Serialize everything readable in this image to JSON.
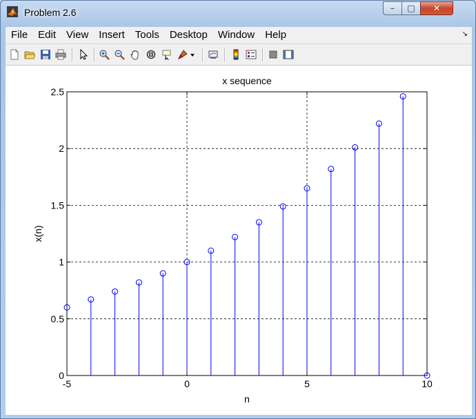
{
  "window": {
    "title": "Problem 2.6",
    "controls": {
      "minimize": "–",
      "maximize": "□",
      "close": "✕"
    }
  },
  "menu": {
    "items": [
      "File",
      "Edit",
      "View",
      "Insert",
      "Tools",
      "Desktop",
      "Window",
      "Help"
    ]
  },
  "toolbar": {
    "icons": [
      "new-figure-icon",
      "open-file-icon",
      "save-icon",
      "print-icon",
      "pointer-icon",
      "zoom-in-icon",
      "zoom-out-icon",
      "pan-icon",
      "rotate-3d-icon",
      "data-cursor-icon",
      "brush-icon",
      "link-plot-icon",
      "colorbar-icon",
      "legend-icon",
      "hide-plot-tools-icon",
      "show-plot-tools-icon"
    ]
  },
  "colors": {
    "stem": "#0000ff",
    "grid": "#000000",
    "axes": "#000000"
  },
  "chart_data": {
    "type": "stem",
    "title": "x sequence",
    "xlabel": "n",
    "ylabel": "x(n)",
    "xlim": [
      -5,
      10
    ],
    "ylim": [
      0,
      2.5
    ],
    "xticks": [
      -5,
      0,
      5,
      10
    ],
    "yticks": [
      0,
      0.5,
      1,
      1.5,
      2,
      2.5
    ],
    "xtick_labels": [
      "-5",
      "0",
      "5",
      "10"
    ],
    "ytick_labels": [
      "0",
      "0.5",
      "1",
      "1.5",
      "2",
      "2.5"
    ],
    "grid": true,
    "x": [
      -5,
      -4,
      -3,
      -2,
      -1,
      0,
      1,
      2,
      3,
      4,
      5,
      6,
      7,
      8,
      9,
      10
    ],
    "values": [
      0.6,
      0.67,
      0.74,
      0.82,
      0.9,
      1.0,
      1.1,
      1.22,
      1.35,
      1.49,
      1.65,
      1.82,
      2.01,
      2.22,
      2.46,
      0
    ]
  }
}
